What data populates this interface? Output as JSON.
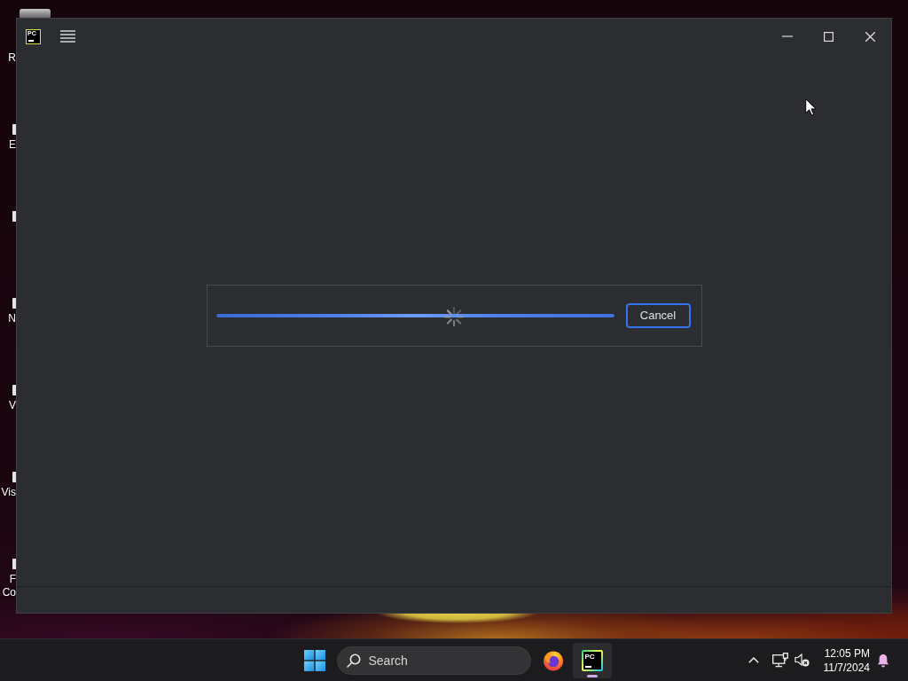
{
  "desktop": {
    "icons": [
      {
        "kind": "bin",
        "label_lines": [
          "R"
        ]
      },
      {
        "kind": "shortcut",
        "label_lines": [
          "E"
        ]
      },
      {
        "kind": "shortcut"
      },
      {
        "kind": "shortcut",
        "label_lines": [
          "N"
        ]
      },
      {
        "kind": "shortcut",
        "label_lines": [
          "V"
        ]
      },
      {
        "kind": "shortcut",
        "label_lines": [
          "Vis"
        ]
      },
      {
        "kind": "shortcut",
        "label_lines": [
          "F",
          "Co"
        ]
      }
    ]
  },
  "window": {
    "logo_text": "PC",
    "dialog": {
      "progress": {
        "level": 1
      },
      "cancel_button": {
        "label": "Cancel",
        "focused": true
      }
    }
  },
  "taskbar": {
    "search": {
      "placeholder": "Search"
    },
    "apps": [
      {
        "kind": "browser",
        "selected": false
      },
      {
        "kind": "ide",
        "logo_text": "PC",
        "selected": true
      }
    ],
    "tray": {
      "time": "12:05 PM",
      "date": "11/7/2024"
    }
  }
}
